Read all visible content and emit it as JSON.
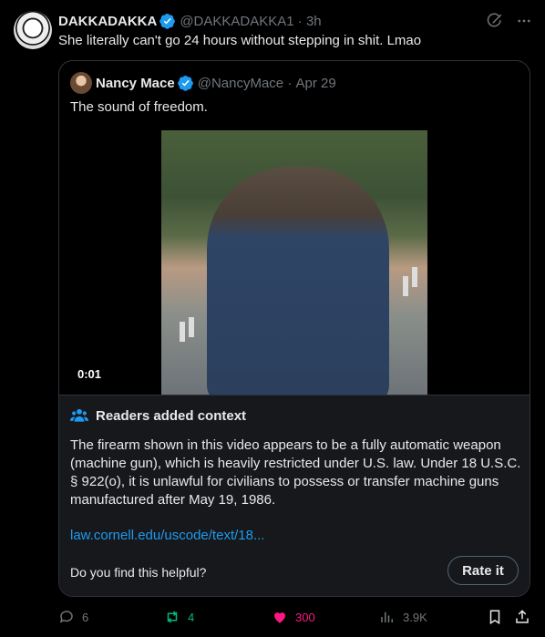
{
  "tweet": {
    "author_name": "DAKKADAKKA",
    "handle": "@DAKKADAKKA1",
    "time": "3h",
    "text": "She literally can't go 24 hours without stepping in shit. Lmao"
  },
  "quoted": {
    "author_name": "Nancy Mace",
    "handle": "@NancyMace",
    "date": "Apr 29",
    "text": "The sound of freedom.",
    "video_time": "0:01"
  },
  "community_note": {
    "title": "Readers added context",
    "body": "The firearm shown in this video appears to be a fully automatic weapon (machine gun), which is heavily restricted under U.S. law. Under 18 U.S.C. § 922(o), it is unlawful for civilians to possess or transfer machine guns manufactured after May 19, 1986.",
    "link": "law.cornell.edu/uscode/text/18...",
    "helpful_prompt": "Do you find this helpful?",
    "rate_label": "Rate it"
  },
  "actions": {
    "replies": "6",
    "reposts": "4",
    "likes": "300",
    "views": "3.9K"
  },
  "colors": {
    "accent": "#1d9bf0",
    "repost_active": "#00ba7c",
    "like_active": "#f91880",
    "muted": "#71767b"
  },
  "icons": [
    "verified-badge-icon",
    "grok-icon",
    "more-icon",
    "people-icon",
    "reply-icon",
    "repost-icon",
    "heart-icon",
    "views-icon",
    "bookmark-icon",
    "share-icon"
  ]
}
